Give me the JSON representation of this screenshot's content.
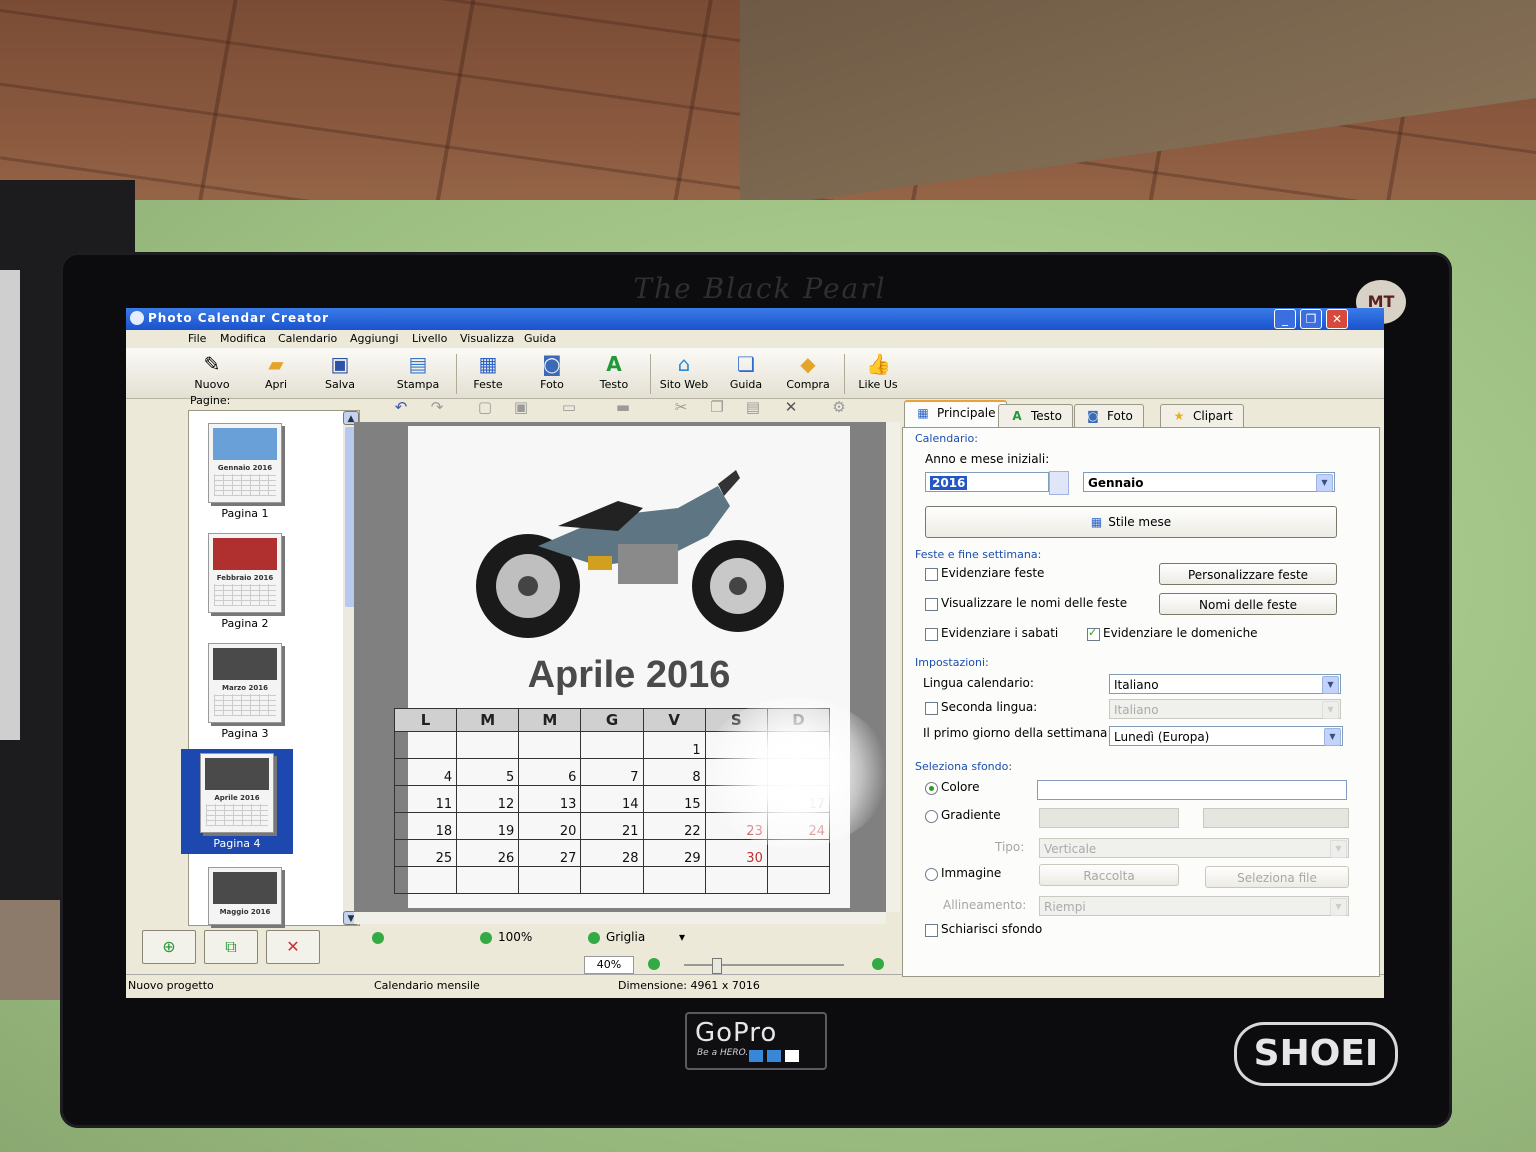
{
  "window": {
    "title": "Photo Calendar Creator"
  },
  "bezel": {
    "brand": "The Black Pearl",
    "gopro": "GoPro",
    "gopro_tag": "Be a HERO.",
    "shoei": "SHOEI",
    "mt_badge": "MT"
  },
  "menu": [
    "File",
    "Modifica",
    "Calendario",
    "Aggiungi",
    "Livello",
    "Visualizza",
    "Guida"
  ],
  "toolbar": [
    {
      "label": "Nuovo",
      "icon": "new-icon"
    },
    {
      "label": "Apri",
      "icon": "open-folder-icon"
    },
    {
      "label": "Salva",
      "icon": "save-icon"
    },
    {
      "label": "Stampa",
      "icon": "print-icon"
    },
    {
      "label": "Feste",
      "icon": "calendar-icon"
    },
    {
      "label": "Foto",
      "icon": "camera-icon"
    },
    {
      "label": "Testo",
      "icon": "text-icon"
    },
    {
      "label": "Sito Web",
      "icon": "home-web-icon"
    },
    {
      "label": "Guida",
      "icon": "book-icon"
    },
    {
      "label": "Compra",
      "icon": "cart-icon"
    },
    {
      "label": "Like Us",
      "icon": "thumbs-up-icon"
    }
  ],
  "pages": {
    "label": "Pagine:",
    "items": [
      {
        "label": "Pagina 1",
        "caption": "Gennaio 2016"
      },
      {
        "label": "Pagina 2",
        "caption": "Febbraio 2016"
      },
      {
        "label": "Pagina 3",
        "caption": "Marzo 2016"
      },
      {
        "label": "Pagina 4",
        "caption": "Aprile 2016",
        "selected": true
      },
      {
        "label": "",
        "caption": "Maggio 2016"
      }
    ]
  },
  "calendar": {
    "title": "Aprile 2016",
    "weekdays": [
      "L",
      "M",
      "M",
      "G",
      "V",
      "S",
      "D"
    ],
    "weeks": [
      [
        "",
        "",
        "",
        "",
        "1",
        "",
        ""
      ],
      [
        "4",
        "5",
        "6",
        "7",
        "8",
        "",
        ""
      ],
      [
        "11",
        "12",
        "13",
        "14",
        "15",
        "",
        "17"
      ],
      [
        "18",
        "19",
        "20",
        "21",
        "22",
        "23",
        "24"
      ],
      [
        "25",
        "26",
        "27",
        "28",
        "29",
        "30",
        ""
      ],
      [
        "",
        "",
        "",
        "",
        "",
        "",
        ""
      ]
    ]
  },
  "canvas_status": {
    "zoom_btn": "100%",
    "grid_btn": "Griglia",
    "zoom_value": "40%"
  },
  "statusbar": {
    "project": "Nuovo progetto",
    "type": "Calendario mensile",
    "dimension": "Dimensione: 4961 x 7016"
  },
  "tabs": [
    {
      "label": "Principale",
      "icon": "calendar-tab-icon",
      "active": true
    },
    {
      "label": "Testo",
      "icon": "text-tab-icon"
    },
    {
      "label": "Foto",
      "icon": "camera-tab-icon"
    },
    {
      "label": "Clipart",
      "icon": "star-icon"
    }
  ],
  "panel": {
    "calendario": {
      "group": "Calendario:",
      "label": "Anno e mese iniziali:",
      "year": "2016",
      "month": "Gennaio",
      "style_btn": "Stile mese"
    },
    "feste": {
      "group": "Feste e fine settimana:",
      "evidenziare_feste": "Evidenziare feste",
      "visualizzare_nomi": "Visualizzare le nomi delle feste",
      "evidenziare_sabati": "Evidenziare i sabati",
      "evidenziare_domeniche": "Evidenziare le domeniche",
      "personalizzare_btn": "Personalizzare feste",
      "nomi_btn": "Nomi delle feste"
    },
    "impostazioni": {
      "group": "Impostazioni:",
      "lingua_label": "Lingua calendario:",
      "lingua_value": "Italiano",
      "seconda_label": "Seconda lingua:",
      "seconda_value": "Italiano",
      "primo_label": "Il primo giorno della settimana",
      "primo_value": "Lunedì (Europa)"
    },
    "sfondo": {
      "group": "Seleziona sfondo:",
      "colore": "Colore",
      "gradiente": "Gradiente",
      "tipo_label": "Tipo:",
      "tipo_value": "Verticale",
      "immagine": "Immagine",
      "raccolta_btn": "Raccolta",
      "seleziona_btn": "Seleziona file",
      "allineamento_label": "Allineamento:",
      "allineamento_value": "Riempi",
      "schiarisci": "Schiarisci sfondo"
    }
  }
}
